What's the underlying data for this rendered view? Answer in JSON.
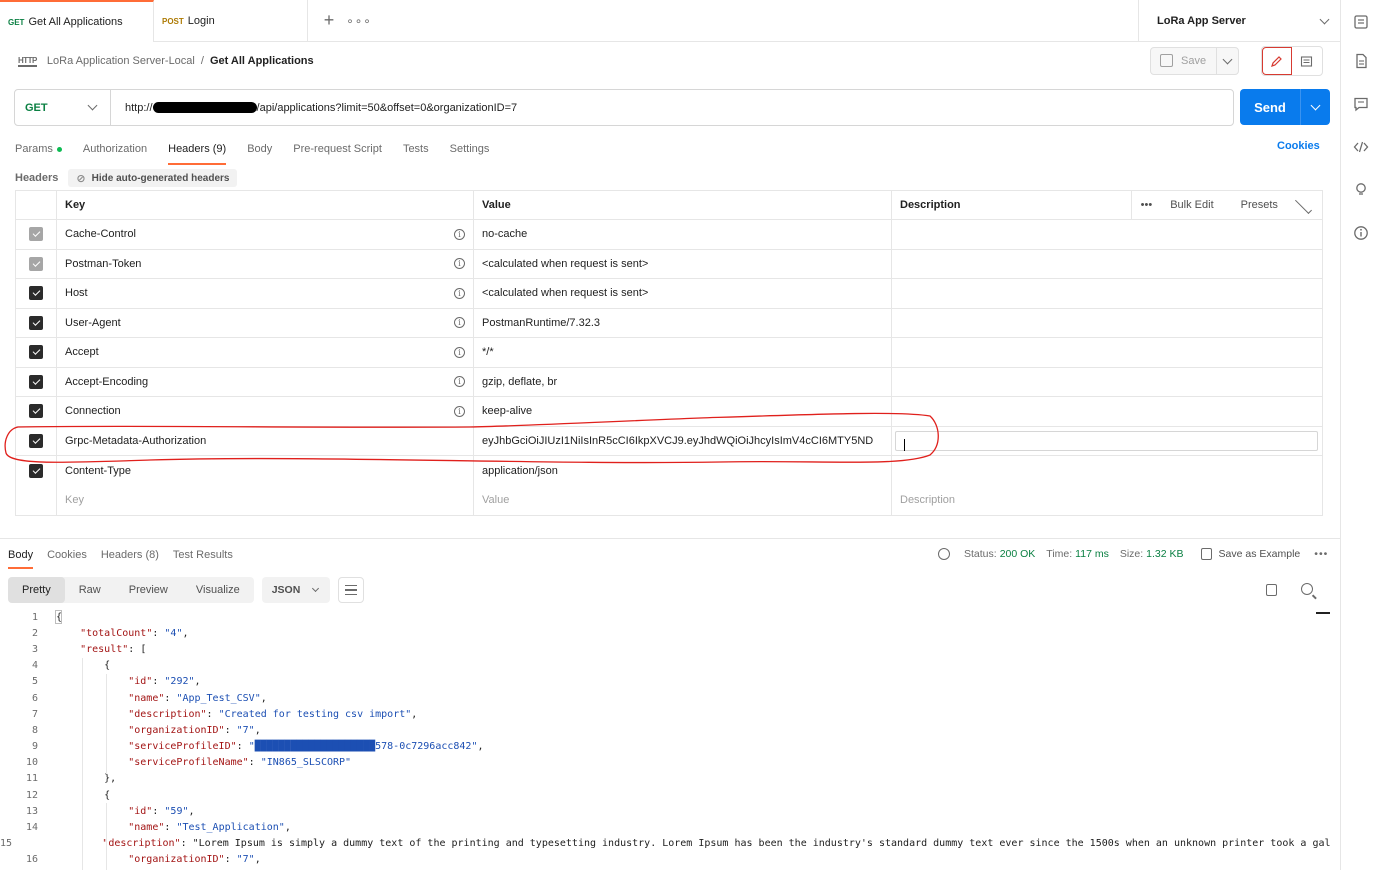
{
  "tabs": [
    {
      "method": "GET",
      "label": "Get All Applications",
      "active": true
    },
    {
      "method": "POST",
      "label": "Login",
      "active": false
    }
  ],
  "environment": "LoRa App Server",
  "breadcrumb": {
    "collection": "LoRa Application Server-Local",
    "separator": "/",
    "request": "Get All Applications"
  },
  "toolbar": {
    "save_label": "Save"
  },
  "request": {
    "method": "GET",
    "url_prefix": "http://",
    "url_suffix": "/api/applications?limit=50&offset=0&organizationID=7",
    "send_label": "Send"
  },
  "request_tabs": [
    {
      "label": "Params",
      "dot": true
    },
    {
      "label": "Authorization"
    },
    {
      "label": "Headers (9)",
      "active": true
    },
    {
      "label": "Body"
    },
    {
      "label": "Pre-request Script"
    },
    {
      "label": "Tests"
    },
    {
      "label": "Settings"
    }
  ],
  "cookies_label": "Cookies",
  "headers_section": {
    "title": "Headers",
    "hide_auto_label": "Hide auto-generated headers",
    "columns": {
      "key": "Key",
      "value": "Value",
      "description": "Description"
    },
    "bulk_edit": "Bulk Edit",
    "presets": "Presets",
    "rows": [
      {
        "key": "Cache-Control",
        "value": "no-cache",
        "checked": true,
        "auto": true
      },
      {
        "key": "Postman-Token",
        "value": "<calculated when request is sent>",
        "checked": true,
        "auto": true
      },
      {
        "key": "Host",
        "value": "<calculated when request is sent>",
        "checked": true,
        "auto": false
      },
      {
        "key": "User-Agent",
        "value": "PostmanRuntime/7.32.3",
        "checked": true,
        "auto": false
      },
      {
        "key": "Accept",
        "value": "*/*",
        "checked": true,
        "auto": false
      },
      {
        "key": "Accept-Encoding",
        "value": "gzip, deflate, br",
        "checked": true,
        "auto": false
      },
      {
        "key": "Connection",
        "value": "keep-alive",
        "checked": true,
        "auto": false
      },
      {
        "key": "Grpc-Metadata-Authorization",
        "value": "eyJhbGciOiJIUzI1NiIsInR5cCI6IkpXVCJ9.eyJhdWQiOiJhcyIsImV4cCI6MTY5ND",
        "checked": true,
        "auto": false
      },
      {
        "key": "Content-Type",
        "value": "application/json",
        "checked": true,
        "auto": false
      }
    ],
    "empty_row": {
      "key": "Key",
      "value": "Value",
      "description": "Description"
    }
  },
  "response": {
    "tabs": [
      "Body",
      "Cookies",
      "Headers (8)",
      "Test Results"
    ],
    "status_label": "Status:",
    "status": "200 OK",
    "time_label": "Time:",
    "time": "117 ms",
    "size_label": "Size:",
    "size": "1.32 KB",
    "save_example": "Save as Example",
    "views": [
      "Pretty",
      "Raw",
      "Preview",
      "Visualize"
    ],
    "format": "JSON",
    "code_lines": [
      "{",
      "    \"totalCount\": \"4\",",
      "    \"result\": [",
      "        {",
      "            \"id\": \"292\",",
      "            \"name\": \"App_Test_CSV\",",
      "            \"description\": \"Created for testing csv import\",",
      "            \"organizationID\": \"7\",",
      "            \"serviceProfileID\": \"████████████████████578-0c7296acc842\",",
      "            \"serviceProfileName\": \"IN865_SLSCORP\"",
      "        },",
      "        {",
      "            \"id\": \"59\",",
      "            \"name\": \"Test_Application\",",
      "            \"description\": \"Lorem Ipsum is simply a dummy text of the printing and typesetting industry. Lorem Ipsum has been the industry's standard dummy text ever since the 1500s when an unknown printer took a gal",
      "            \"organizationID\": \"7\","
    ]
  },
  "colors": {
    "accent": "#ff6c37",
    "send": "#097bed",
    "get": "#0b8043",
    "annotation": "#e0201c"
  }
}
